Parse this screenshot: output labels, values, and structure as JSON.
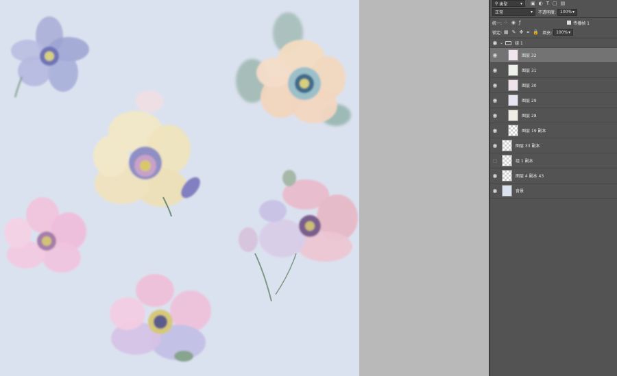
{
  "layers_panel": {
    "filter_kind": "类型",
    "blend_mode": "正常",
    "opacity_label": "不透明度:",
    "opacity_value": "100%",
    "unify_label": "统一:",
    "propagate_frame_label": "传播帧 1",
    "lock_label": "锁定:",
    "fill_label": "填充:",
    "fill_value": "100%",
    "layers": [
      {
        "name": "组 1",
        "type": "group",
        "visible": true
      },
      {
        "name": "图层 32",
        "visible": true,
        "selected": true
      },
      {
        "name": "图层 31",
        "visible": true
      },
      {
        "name": "图层 30",
        "visible": true
      },
      {
        "name": "图层 29",
        "visible": true
      },
      {
        "name": "图层 28",
        "visible": true
      },
      {
        "name": "图层 19 副本",
        "visible": true
      },
      {
        "name": "图层 33 副本",
        "visible": true
      },
      {
        "name": "组 1 副本",
        "visible": false
      },
      {
        "name": "图层 4 副本 43",
        "visible": true
      },
      {
        "name": "背景",
        "visible": true
      }
    ]
  },
  "colors": {
    "canvas_bg": "#dbe2ef",
    "workspace_bg": "#b9b9b9",
    "panel_bg": "#535353",
    "selected_layer": "#737373"
  },
  "icons": [
    "search-icon",
    "eye-icon",
    "folder-icon",
    "lock-icon",
    "checkbox-icon",
    "chevron-down-icon"
  ]
}
